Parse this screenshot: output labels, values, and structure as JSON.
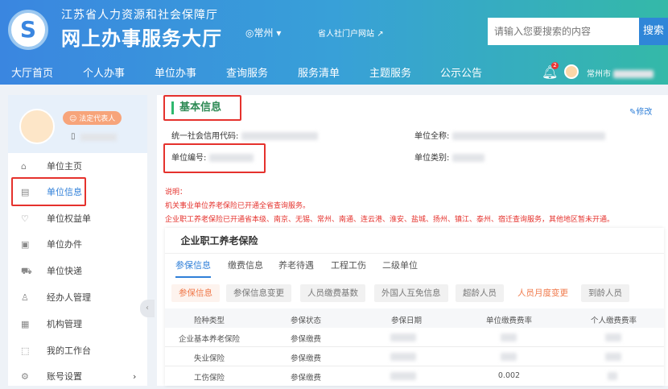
{
  "header": {
    "org": "江苏省人力资源和社会保障厅",
    "title": "网上办事服务大厅",
    "city": "常州",
    "portal": "省人社门户网站",
    "search_placeholder": "请输入您要搜索的内容",
    "search_button": "搜索",
    "notifications": "2",
    "user": "常州市"
  },
  "nav": [
    "大厅首页",
    "个人办事",
    "单位办事",
    "查询服务",
    "服务清单",
    "主题服务",
    "公示公告"
  ],
  "sidebar": {
    "role_badge": "法定代表人",
    "items": [
      {
        "label": "单位主页",
        "icon": "home-icon"
      },
      {
        "label": "单位信息",
        "icon": "document-icon",
        "active": true
      },
      {
        "label": "单位权益单",
        "icon": "shield-icon"
      },
      {
        "label": "单位办件",
        "icon": "file-icon"
      },
      {
        "label": "单位快递",
        "icon": "truck-icon"
      },
      {
        "label": "经办人管理",
        "icon": "user-icon"
      },
      {
        "label": "机构管理",
        "icon": "building-icon"
      },
      {
        "label": "我的工作台",
        "icon": "chart-icon"
      },
      {
        "label": "账号设置",
        "icon": "gear-icon"
      }
    ]
  },
  "basic": {
    "title": "基本信息",
    "edit": "修改",
    "fields": [
      {
        "label": "统一社会信用代码:"
      },
      {
        "label": "单位全称:"
      },
      {
        "label": "单位编号:"
      },
      {
        "label": "单位类别:"
      }
    ]
  },
  "notes": {
    "heading": "说明：",
    "lines": [
      "机关事业单位养老保险已开通全省查询服务。",
      "企业职工养老保险已开通省本级、南京、无锡、常州、南通、连云港、淮安、盐城、扬州、镇江、泰州、宿迁查询服务，其他地区暂未开通。"
    ]
  },
  "insurance": {
    "card_title": "企业职工养老保险",
    "tabs": [
      "参保信息",
      "缴费信息",
      "养老待遇",
      "工程工伤",
      "二级单位"
    ],
    "sub_buttons": [
      "参保信息",
      "参保信息变更",
      "人员缴费基数",
      "外国人互免信息",
      "超龄人员",
      "人员月度变更",
      "到龄人员"
    ],
    "columns": [
      "险种类型",
      "参保状态",
      "参保日期",
      "单位缴费费率",
      "个人缴费费率"
    ],
    "rows": [
      {
        "type": "企业基本养老保险",
        "status": "参保缴费",
        "unit_rate": ""
      },
      {
        "type": "失业保险",
        "status": "参保缴费",
        "unit_rate": ""
      },
      {
        "type": "工伤保险",
        "status": "参保缴费",
        "unit_rate": "0.002"
      }
    ]
  },
  "colors": {
    "brand": "#3a86e0",
    "accent_red": "#e5322d",
    "orange": "#f0794a",
    "green": "#2eb86e"
  }
}
